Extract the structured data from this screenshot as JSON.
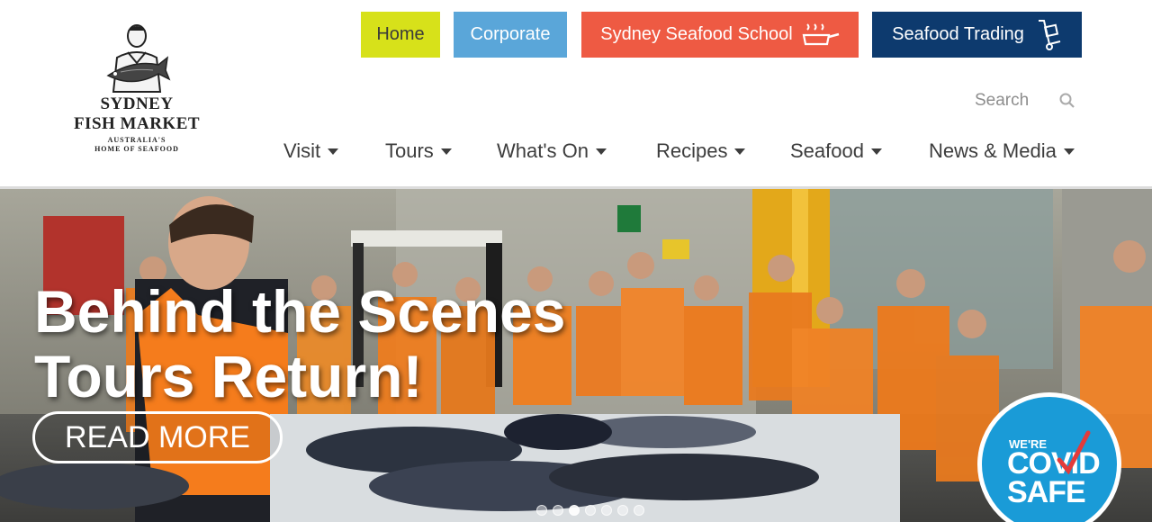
{
  "logo": {
    "line1": "SYDNEY",
    "line2": "FISH MARKET",
    "line3": "AUSTRALIA'S",
    "line4": "HOME OF SEAFOOD",
    "icon": "fishmonger-illustration"
  },
  "top_buttons": {
    "home": "Home",
    "corporate": "Corporate",
    "school": "Sydney Seafood School",
    "school_icon": "steaming-pan-icon",
    "trading": "Seafood Trading",
    "trading_icon": "hand-trolley-icon"
  },
  "search": {
    "placeholder": "Search",
    "icon": "search-icon"
  },
  "nav": {
    "visit": "Visit",
    "tours": "Tours",
    "whats_on": "What's On",
    "recipes": "Recipes",
    "seafood": "Seafood",
    "news": "News & Media"
  },
  "hero": {
    "title_line1": "Behind the Scenes",
    "title_line2": "Tours Return!",
    "cta": "READ MORE",
    "badge_small": "WE'RE",
    "badge_line1": "COVID",
    "badge_line2": "SAFE",
    "slide_count": 7,
    "active_slide": 3
  },
  "colors": {
    "home": "#d7e11a",
    "corporate": "#5aa6d9",
    "school": "#ee5a43",
    "trading": "#0d3a6e",
    "covid_badge": "#1a9bd7"
  }
}
